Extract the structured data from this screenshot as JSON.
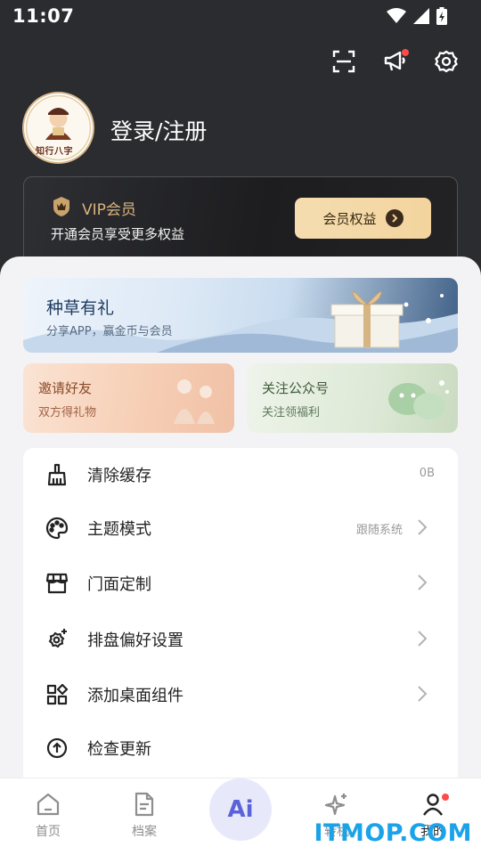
{
  "status_bar": {
    "time": "11:07"
  },
  "profile": {
    "login_text": "登录/注册",
    "avatar_text": "知行八字"
  },
  "vip": {
    "title": "VIP会员",
    "subtitle": "开通会员享受更多权益",
    "button": "会员权益"
  },
  "banner": {
    "title": "种草有礼",
    "subtitle": "分享APP，赢金币与会员"
  },
  "cards": [
    {
      "title": "邀请好友",
      "subtitle": "双方得礼物"
    },
    {
      "title": "关注公众号",
      "subtitle": "关注领福利"
    }
  ],
  "settings": [
    {
      "label": "清除缓存",
      "value": "0B",
      "icon": "broom-icon"
    },
    {
      "label": "主题模式",
      "value": "跟随系统",
      "icon": "palette-icon"
    },
    {
      "label": "门面定制",
      "value": "",
      "icon": "storefront-icon"
    },
    {
      "label": "排盘偏好设置",
      "value": "",
      "icon": "gear-sparkle-icon"
    },
    {
      "label": "添加桌面组件",
      "value": "",
      "icon": "widgets-icon"
    },
    {
      "label": "检查更新",
      "value": "",
      "icon": "upload-circle-icon"
    }
  ],
  "nav": {
    "home": "首页",
    "archive": "档案",
    "ai": "Ai",
    "fortune": "转机",
    "mine": "我的"
  },
  "watermark": "ITMOP.COM",
  "colors": {
    "accent": "#5a63d8",
    "vip_gold": "#d8b27c",
    "badge_red": "#ff4a4a"
  }
}
